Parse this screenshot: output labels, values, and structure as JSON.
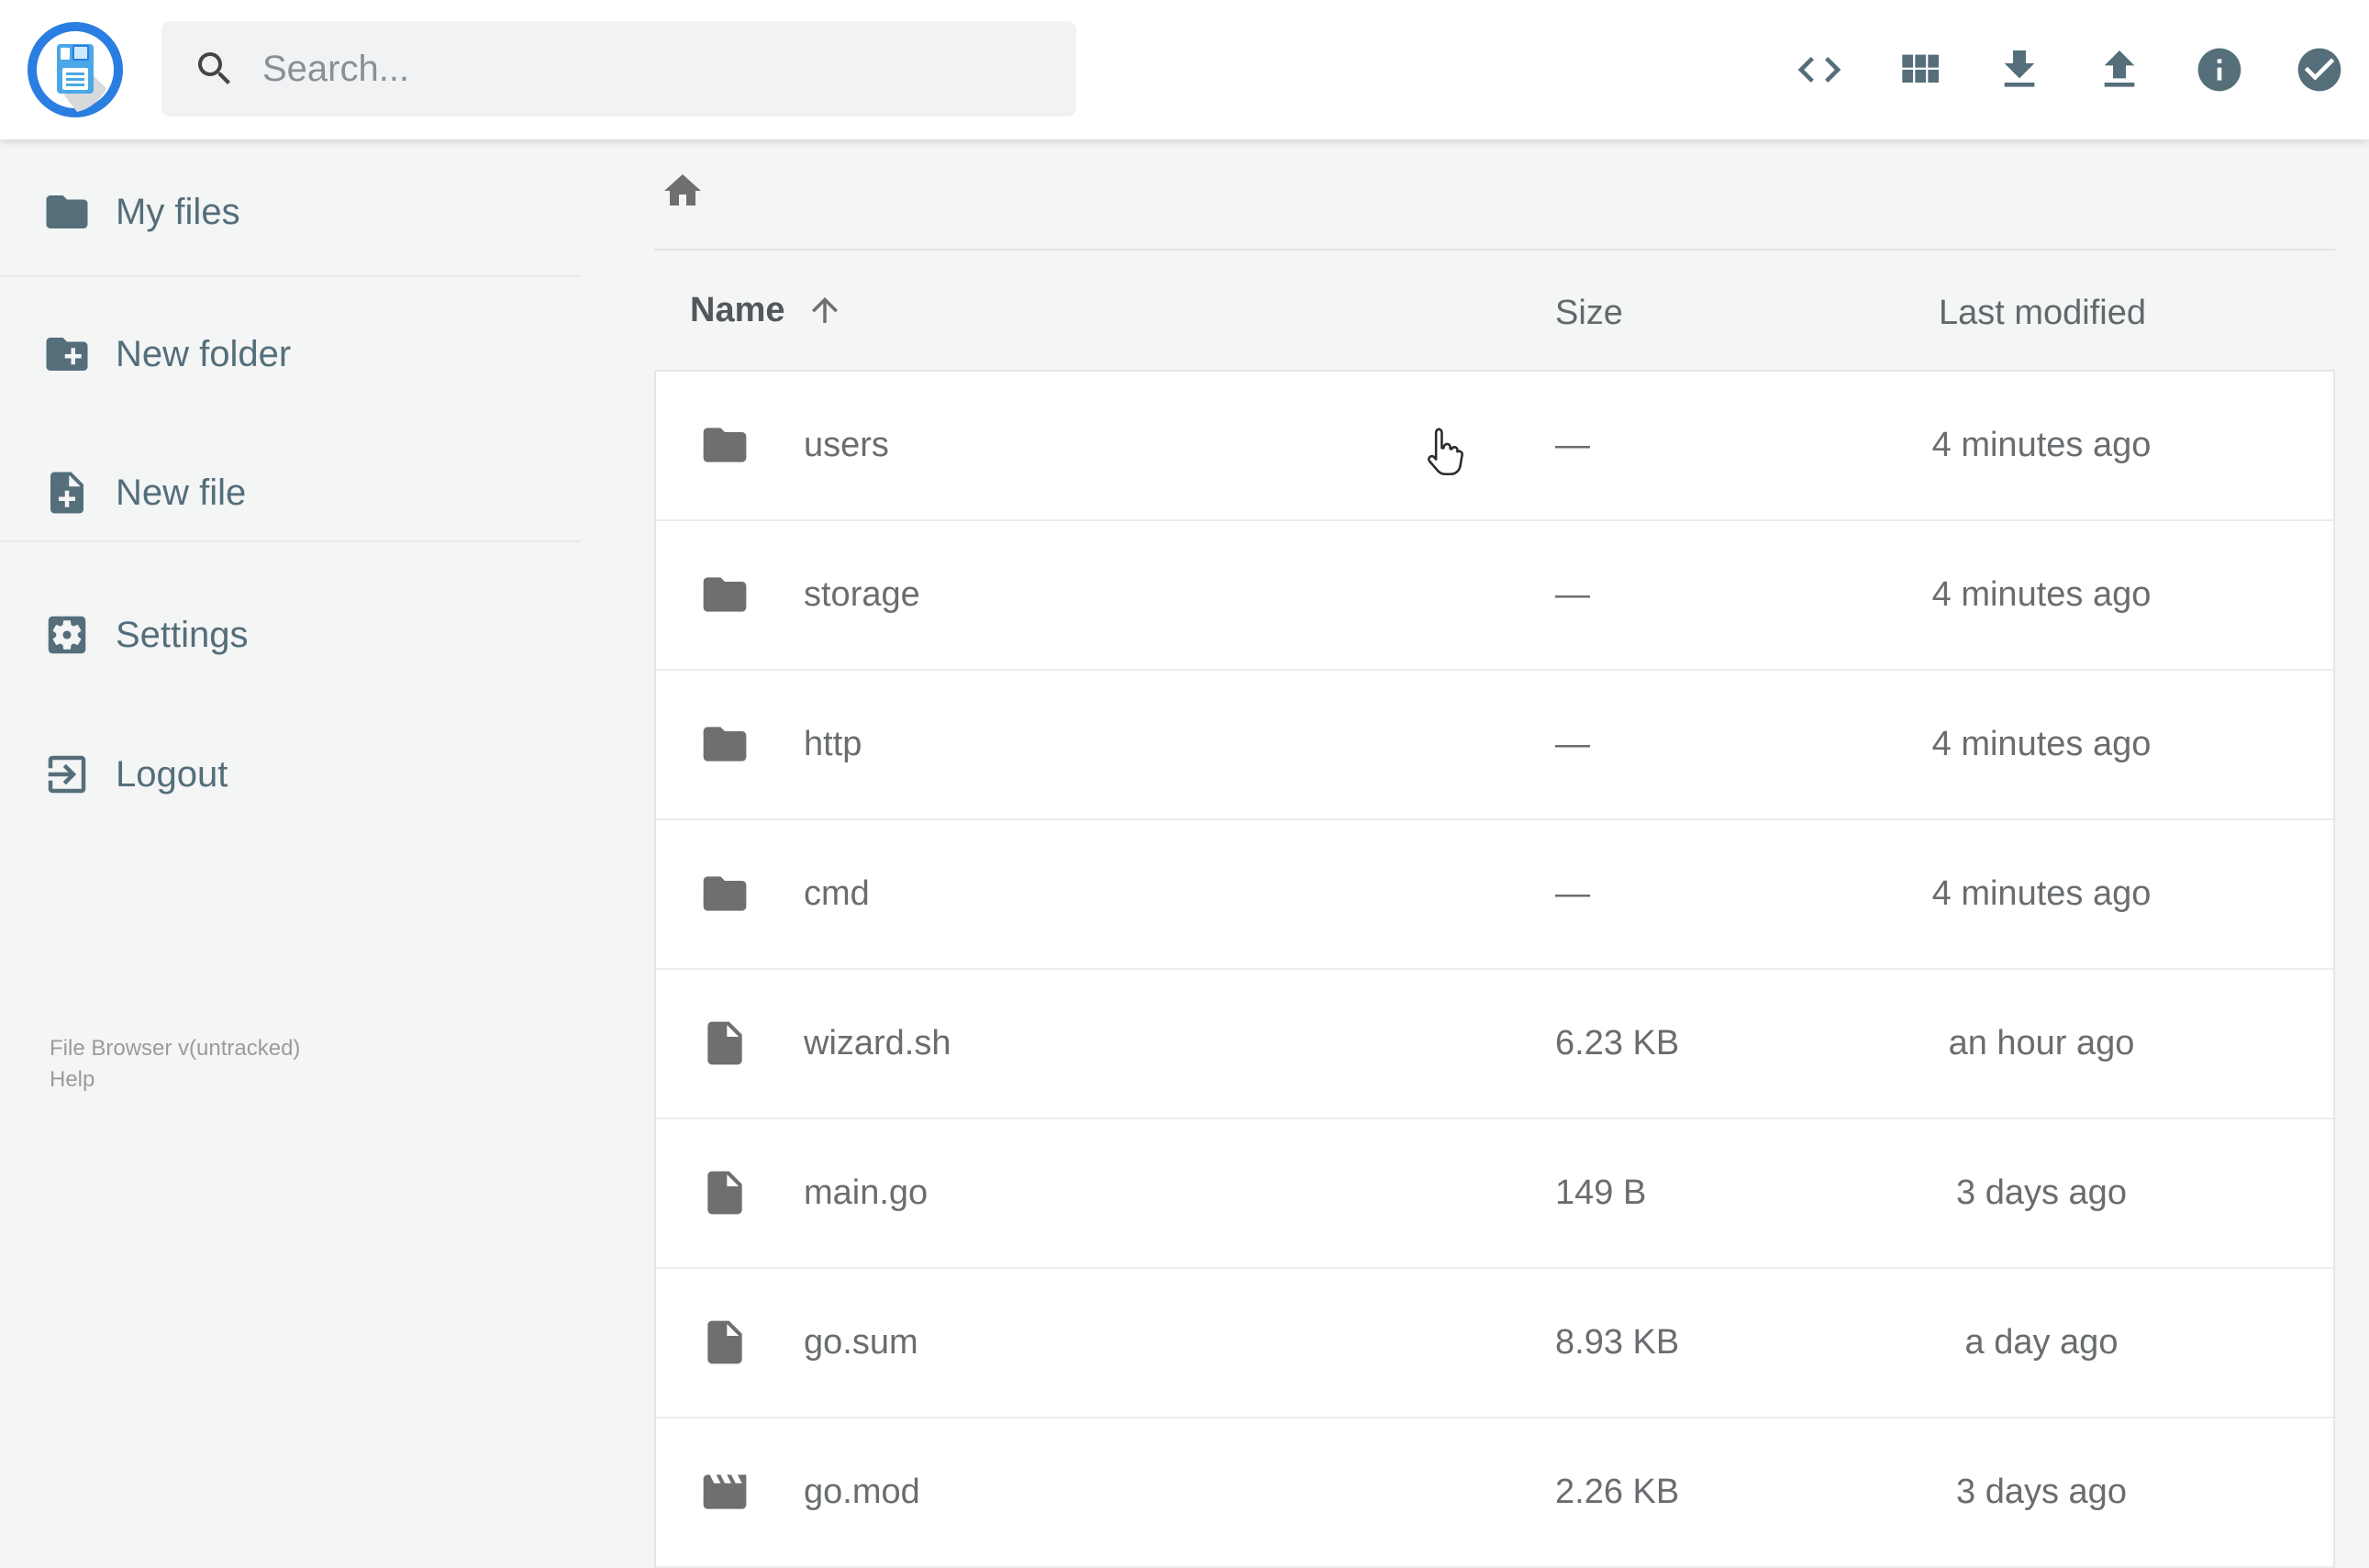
{
  "app": {
    "name": "File Browser"
  },
  "header": {
    "search": {
      "placeholder": "Search..."
    },
    "action_icons": [
      "code",
      "view-module",
      "download",
      "upload",
      "info",
      "select-multiple"
    ]
  },
  "sidebar": {
    "items": [
      {
        "label": "My files",
        "icon": "folder"
      },
      {
        "label": "New folder",
        "icon": "folder-plus"
      },
      {
        "label": "New file",
        "icon": "file-plus"
      },
      {
        "label": "Settings",
        "icon": "settings"
      },
      {
        "label": "Logout",
        "icon": "logout"
      }
    ],
    "footer": {
      "version": "File Browser v(untracked)",
      "help": "Help"
    }
  },
  "breadcrumb": {
    "root_icon": "home"
  },
  "listing": {
    "columns": {
      "name": "Name",
      "size": "Size",
      "modified": "Last modified"
    },
    "sort": {
      "column": "name",
      "direction": "asc"
    },
    "rows": [
      {
        "name": "users",
        "type": "folder",
        "size": "—",
        "modified": "4 minutes ago"
      },
      {
        "name": "storage",
        "type": "folder",
        "size": "—",
        "modified": "4 minutes ago"
      },
      {
        "name": "http",
        "type": "folder",
        "size": "—",
        "modified": "4 minutes ago"
      },
      {
        "name": "cmd",
        "type": "folder",
        "size": "—",
        "modified": "4 minutes ago"
      },
      {
        "name": "wizard.sh",
        "type": "file",
        "size": "6.23 KB",
        "modified": "an hour ago"
      },
      {
        "name": "main.go",
        "type": "file",
        "size": "149 B",
        "modified": "3 days ago"
      },
      {
        "name": "go.sum",
        "type": "file",
        "size": "8.93 KB",
        "modified": "a day ago"
      },
      {
        "name": "go.mod",
        "type": "movie",
        "size": "2.26 KB",
        "modified": "3 days ago"
      }
    ]
  },
  "colors": {
    "accent_blue": "#2a7de1",
    "logo_light_blue": "#4aa8e8",
    "slate": "#546e7a",
    "icon_gray": "#6f6f6f",
    "page_bg": "#f4f5f5"
  }
}
